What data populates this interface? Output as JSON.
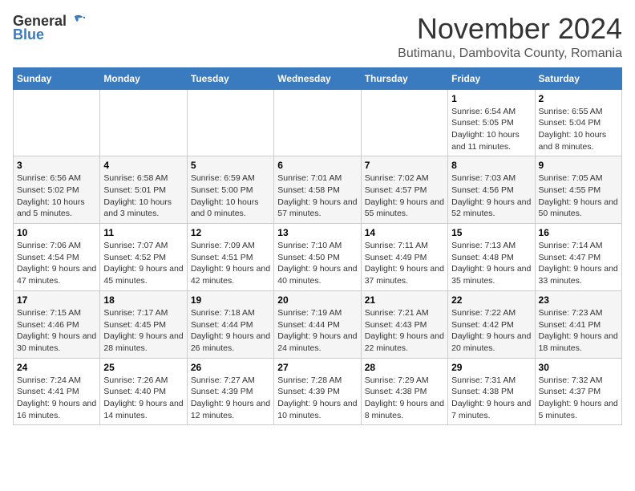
{
  "header": {
    "logo_general": "General",
    "logo_blue": "Blue",
    "month_year": "November 2024",
    "location": "Butimanu, Dambovita County, Romania"
  },
  "weekdays": [
    "Sunday",
    "Monday",
    "Tuesday",
    "Wednesday",
    "Thursday",
    "Friday",
    "Saturday"
  ],
  "weeks": [
    [
      {
        "day": "",
        "info": ""
      },
      {
        "day": "",
        "info": ""
      },
      {
        "day": "",
        "info": ""
      },
      {
        "day": "",
        "info": ""
      },
      {
        "day": "",
        "info": ""
      },
      {
        "day": "1",
        "info": "Sunrise: 6:54 AM\nSunset: 5:05 PM\nDaylight: 10 hours and 11 minutes."
      },
      {
        "day": "2",
        "info": "Sunrise: 6:55 AM\nSunset: 5:04 PM\nDaylight: 10 hours and 8 minutes."
      }
    ],
    [
      {
        "day": "3",
        "info": "Sunrise: 6:56 AM\nSunset: 5:02 PM\nDaylight: 10 hours and 5 minutes."
      },
      {
        "day": "4",
        "info": "Sunrise: 6:58 AM\nSunset: 5:01 PM\nDaylight: 10 hours and 3 minutes."
      },
      {
        "day": "5",
        "info": "Sunrise: 6:59 AM\nSunset: 5:00 PM\nDaylight: 10 hours and 0 minutes."
      },
      {
        "day": "6",
        "info": "Sunrise: 7:01 AM\nSunset: 4:58 PM\nDaylight: 9 hours and 57 minutes."
      },
      {
        "day": "7",
        "info": "Sunrise: 7:02 AM\nSunset: 4:57 PM\nDaylight: 9 hours and 55 minutes."
      },
      {
        "day": "8",
        "info": "Sunrise: 7:03 AM\nSunset: 4:56 PM\nDaylight: 9 hours and 52 minutes."
      },
      {
        "day": "9",
        "info": "Sunrise: 7:05 AM\nSunset: 4:55 PM\nDaylight: 9 hours and 50 minutes."
      }
    ],
    [
      {
        "day": "10",
        "info": "Sunrise: 7:06 AM\nSunset: 4:54 PM\nDaylight: 9 hours and 47 minutes."
      },
      {
        "day": "11",
        "info": "Sunrise: 7:07 AM\nSunset: 4:52 PM\nDaylight: 9 hours and 45 minutes."
      },
      {
        "day": "12",
        "info": "Sunrise: 7:09 AM\nSunset: 4:51 PM\nDaylight: 9 hours and 42 minutes."
      },
      {
        "day": "13",
        "info": "Sunrise: 7:10 AM\nSunset: 4:50 PM\nDaylight: 9 hours and 40 minutes."
      },
      {
        "day": "14",
        "info": "Sunrise: 7:11 AM\nSunset: 4:49 PM\nDaylight: 9 hours and 37 minutes."
      },
      {
        "day": "15",
        "info": "Sunrise: 7:13 AM\nSunset: 4:48 PM\nDaylight: 9 hours and 35 minutes."
      },
      {
        "day": "16",
        "info": "Sunrise: 7:14 AM\nSunset: 4:47 PM\nDaylight: 9 hours and 33 minutes."
      }
    ],
    [
      {
        "day": "17",
        "info": "Sunrise: 7:15 AM\nSunset: 4:46 PM\nDaylight: 9 hours and 30 minutes."
      },
      {
        "day": "18",
        "info": "Sunrise: 7:17 AM\nSunset: 4:45 PM\nDaylight: 9 hours and 28 minutes."
      },
      {
        "day": "19",
        "info": "Sunrise: 7:18 AM\nSunset: 4:44 PM\nDaylight: 9 hours and 26 minutes."
      },
      {
        "day": "20",
        "info": "Sunrise: 7:19 AM\nSunset: 4:44 PM\nDaylight: 9 hours and 24 minutes."
      },
      {
        "day": "21",
        "info": "Sunrise: 7:21 AM\nSunset: 4:43 PM\nDaylight: 9 hours and 22 minutes."
      },
      {
        "day": "22",
        "info": "Sunrise: 7:22 AM\nSunset: 4:42 PM\nDaylight: 9 hours and 20 minutes."
      },
      {
        "day": "23",
        "info": "Sunrise: 7:23 AM\nSunset: 4:41 PM\nDaylight: 9 hours and 18 minutes."
      }
    ],
    [
      {
        "day": "24",
        "info": "Sunrise: 7:24 AM\nSunset: 4:41 PM\nDaylight: 9 hours and 16 minutes."
      },
      {
        "day": "25",
        "info": "Sunrise: 7:26 AM\nSunset: 4:40 PM\nDaylight: 9 hours and 14 minutes."
      },
      {
        "day": "26",
        "info": "Sunrise: 7:27 AM\nSunset: 4:39 PM\nDaylight: 9 hours and 12 minutes."
      },
      {
        "day": "27",
        "info": "Sunrise: 7:28 AM\nSunset: 4:39 PM\nDaylight: 9 hours and 10 minutes."
      },
      {
        "day": "28",
        "info": "Sunrise: 7:29 AM\nSunset: 4:38 PM\nDaylight: 9 hours and 8 minutes."
      },
      {
        "day": "29",
        "info": "Sunrise: 7:31 AM\nSunset: 4:38 PM\nDaylight: 9 hours and 7 minutes."
      },
      {
        "day": "30",
        "info": "Sunrise: 7:32 AM\nSunset: 4:37 PM\nDaylight: 9 hours and 5 minutes."
      }
    ]
  ]
}
